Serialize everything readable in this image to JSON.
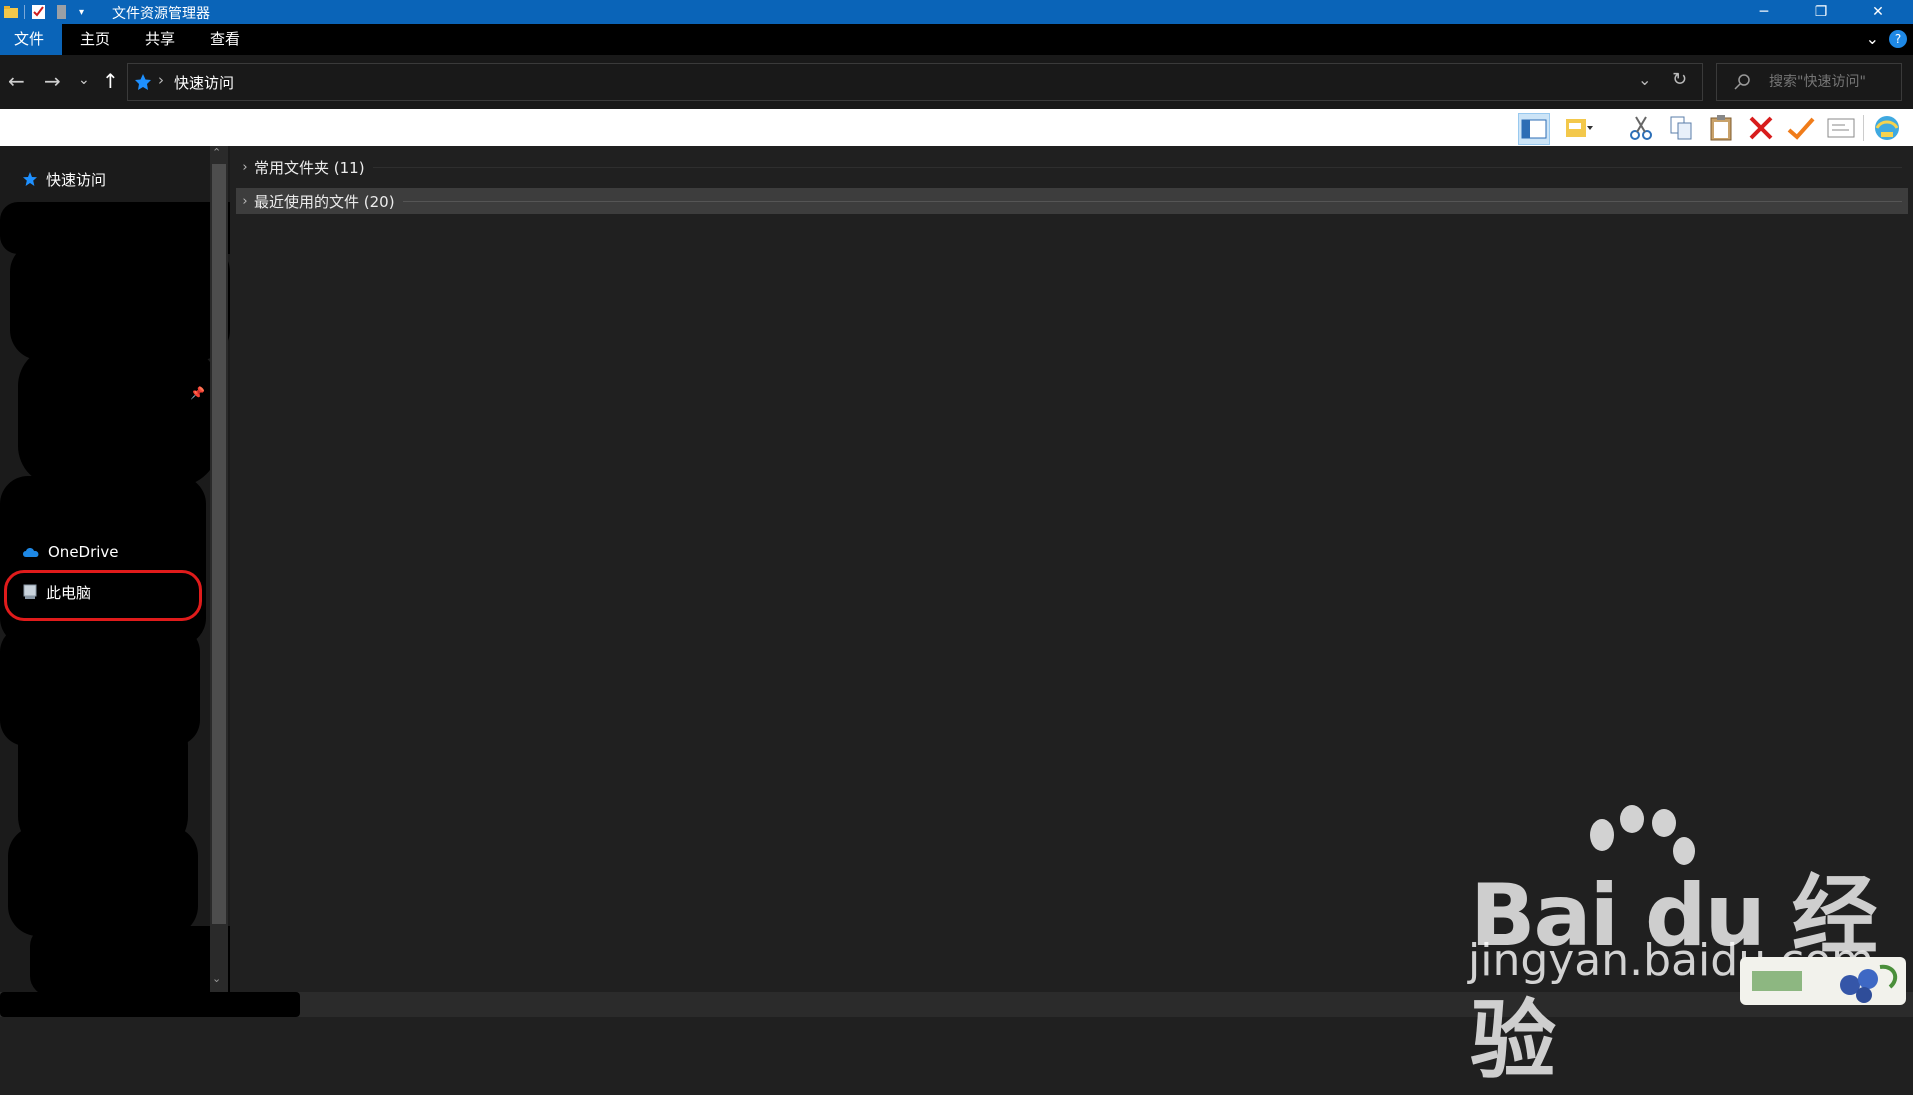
{
  "window": {
    "title": "文件资源管理器",
    "controls": {
      "minimize": "─",
      "restore": "❐",
      "close": "✕"
    }
  },
  "ribbon": {
    "tabs": [
      {
        "label": "文件",
        "active": true
      },
      {
        "label": "主页",
        "active": false
      },
      {
        "label": "共享",
        "active": false
      },
      {
        "label": "查看",
        "active": false
      }
    ],
    "help_label": "?"
  },
  "nav": {
    "back": "←",
    "forward": "→",
    "recent": "⌄",
    "up": "↑",
    "breadcrumb_separator": "›",
    "location": "快速访问",
    "refresh": "↻",
    "dropdown": "⌄",
    "search_placeholder": "搜索\"快速访问\""
  },
  "toolbar": {
    "icons": [
      "preview-pane-icon",
      "details-pane-icon",
      "cut-icon",
      "copy-icon",
      "paste-icon",
      "delete-icon",
      "check-icon",
      "properties-icon",
      "web-icon"
    ]
  },
  "sidebar": {
    "quick_access": "快速访问",
    "onedrive": "OneDrive",
    "this_pc": "此电脑"
  },
  "content": {
    "groups": [
      {
        "label": "常用文件夹 (11)"
      },
      {
        "label": "最近使用的文件 (20)"
      }
    ]
  },
  "watermark": {
    "brand": "Bai du 经验",
    "url": "jingyan.baidu.com"
  },
  "colors": {
    "accent": "#0a64b8",
    "background": "#202020",
    "highlight": "#e01b1b"
  }
}
